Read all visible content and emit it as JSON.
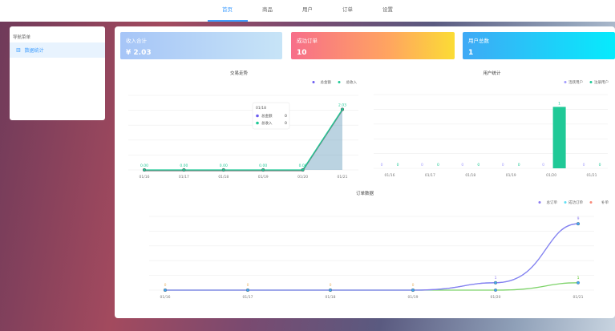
{
  "nav": {
    "items": [
      "首页",
      "商品",
      "用户",
      "订单",
      "设置"
    ],
    "active": 0
  },
  "sidebar": {
    "title": "导航菜单",
    "items": [
      {
        "label": "数据统计",
        "icon": "chart-icon"
      }
    ]
  },
  "cards": [
    {
      "title": "收入合计",
      "value": "¥ 2.03"
    },
    {
      "title": "成功订单",
      "value": "10"
    },
    {
      "title": "用户总数",
      "value": "1"
    }
  ],
  "chart_data": [
    {
      "type": "line",
      "title": "交易走势",
      "categories": [
        "01/16",
        "01/17",
        "01/18",
        "01/19",
        "01/20",
        "01/21"
      ],
      "ylim": [
        0,
        2.5
      ],
      "series": [
        {
          "name": "总金额",
          "color": "#6b5cf0",
          "values": [
            0,
            0,
            0,
            0,
            0,
            2.03
          ]
        },
        {
          "name": "总收入",
          "color": "#20c997",
          "values": [
            0,
            0,
            0,
            0,
            0,
            2.03
          ]
        }
      ],
      "labels": [
        "0.00",
        "0.00",
        "0.00",
        "0.00",
        "0.00",
        "2.03"
      ],
      "tooltip": {
        "title": "01/18",
        "rows": [
          {
            "name": "总金额",
            "value": "0"
          },
          {
            "name": "总收入",
            "value": "0"
          }
        ]
      },
      "legend": "top-right"
    },
    {
      "type": "bar",
      "title": "用户统计",
      "categories": [
        "01/16",
        "01/17",
        "01/18",
        "01/19",
        "01/20",
        "01/21"
      ],
      "ylim": [
        0,
        1.2
      ],
      "series": [
        {
          "name": "活跃用户",
          "color": "#a29bfe",
          "values": [
            0,
            0,
            0,
            0,
            0,
            0
          ]
        },
        {
          "name": "注册用户",
          "color": "#20c997",
          "values": [
            0,
            0,
            0,
            0,
            1,
            0
          ]
        }
      ],
      "legend": "top-right"
    },
    {
      "type": "line",
      "title": "订单数据",
      "categories": [
        "01/16",
        "01/17",
        "01/18",
        "01/19",
        "01/20",
        "01/21"
      ],
      "ylim": [
        0,
        10
      ],
      "series": [
        {
          "name": "总订单",
          "color": "#8c7cf0",
          "values": [
            0,
            0,
            0,
            0,
            1,
            9
          ]
        },
        {
          "name": "成功订单",
          "color": "#5ee0f5",
          "values": [
            0,
            0,
            0,
            0,
            1,
            9
          ]
        },
        {
          "name": "补单",
          "color": "#f98a7a",
          "values": [
            0,
            0,
            0,
            0,
            0,
            1
          ]
        }
      ],
      "legend": "top-right"
    }
  ]
}
